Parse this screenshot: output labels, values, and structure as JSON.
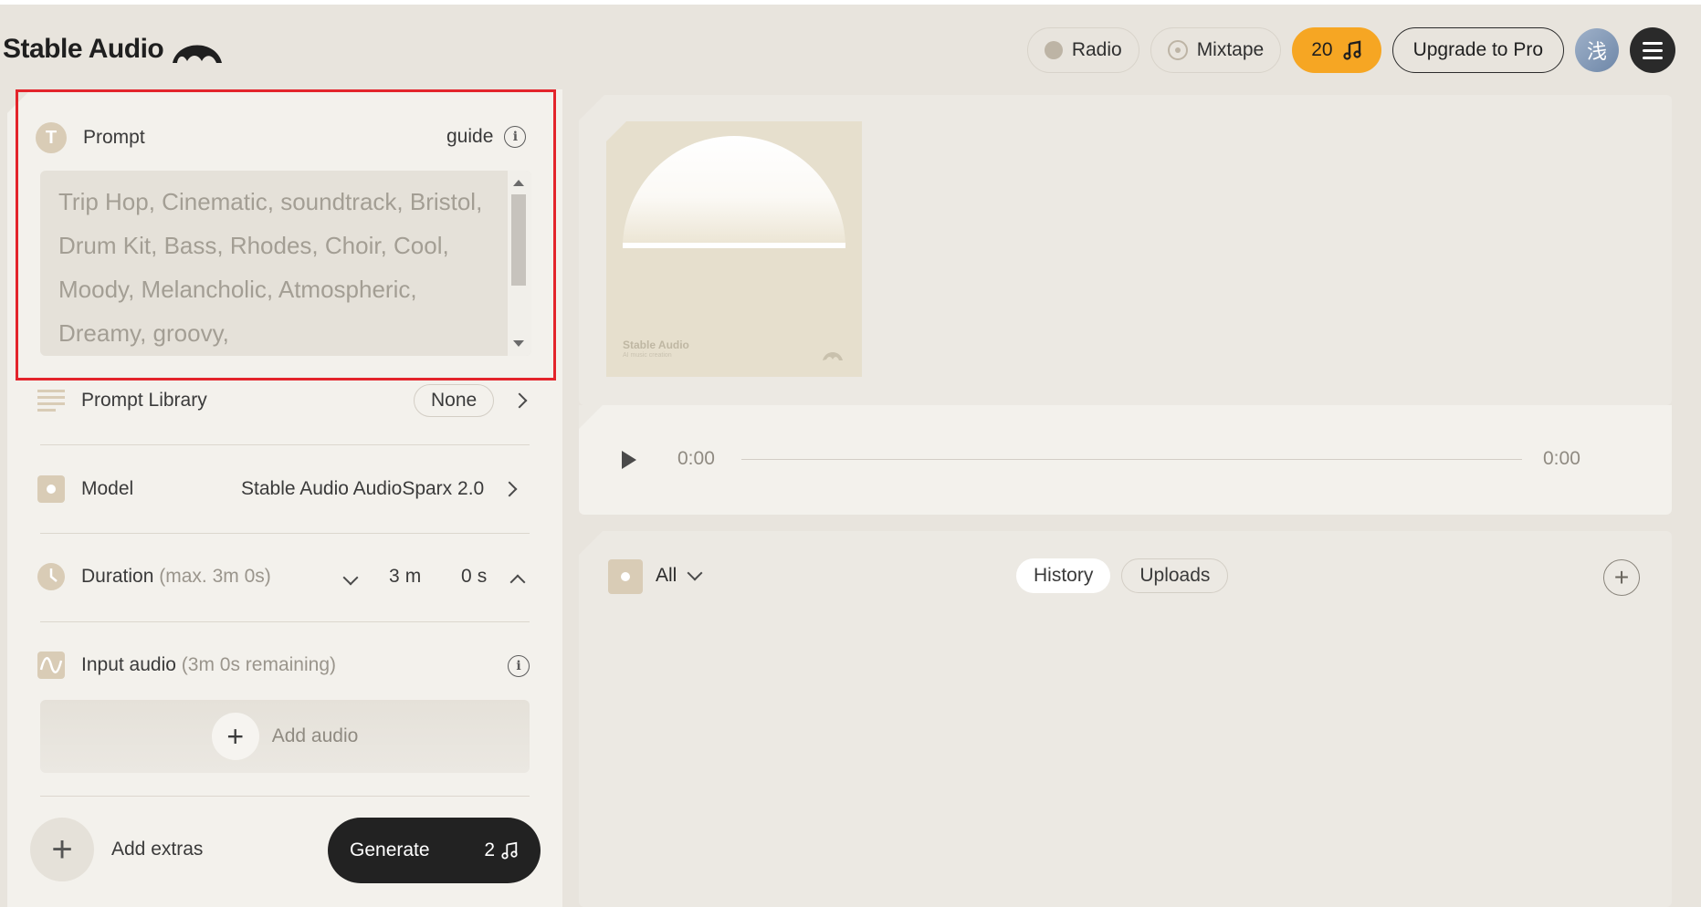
{
  "app": {
    "logo_text": "Stable Audio"
  },
  "nav": {
    "radio_label": "Radio",
    "mixtape_label": "Mixtape",
    "credits_count": "20",
    "upgrade_label": "Upgrade to Pro",
    "avatar_text": "浅"
  },
  "prompt": {
    "title": "Prompt",
    "guide_label": "guide",
    "text": "Trip Hop, Cinematic, soundtrack, Bristol, Drum Kit, Bass, Rhodes, Choir, Cool, Moody, Melancholic, Atmospheric, Dreamy, groovy,",
    "icon_letter": "T"
  },
  "prompt_library": {
    "label": "Prompt Library",
    "value": "None"
  },
  "model": {
    "label": "Model",
    "value": "Stable Audio AudioSparx 2.0"
  },
  "duration": {
    "label": "Duration",
    "hint": "(max. 3m 0s)",
    "minutes": "3",
    "minutes_unit": "m",
    "seconds": "0",
    "seconds_unit": "s"
  },
  "input_audio": {
    "label": "Input audio",
    "hint": "(3m 0s remaining)",
    "add_label": "Add audio"
  },
  "footer": {
    "extras_label": "Add extras",
    "generate_label": "Generate",
    "generate_cost": "2"
  },
  "album": {
    "title": "Stable Audio",
    "subtitle": "AI music creation"
  },
  "player": {
    "current_time": "0:00",
    "total_time": "0:00",
    "progress": 0
  },
  "history": {
    "filter_label": "All",
    "tabs": [
      "History",
      "Uploads"
    ],
    "active_tab": "History"
  },
  "colors": {
    "credits_bg": "#f6a623",
    "highlight": "#e3242b",
    "accent_beige": "#d9ccb6"
  }
}
